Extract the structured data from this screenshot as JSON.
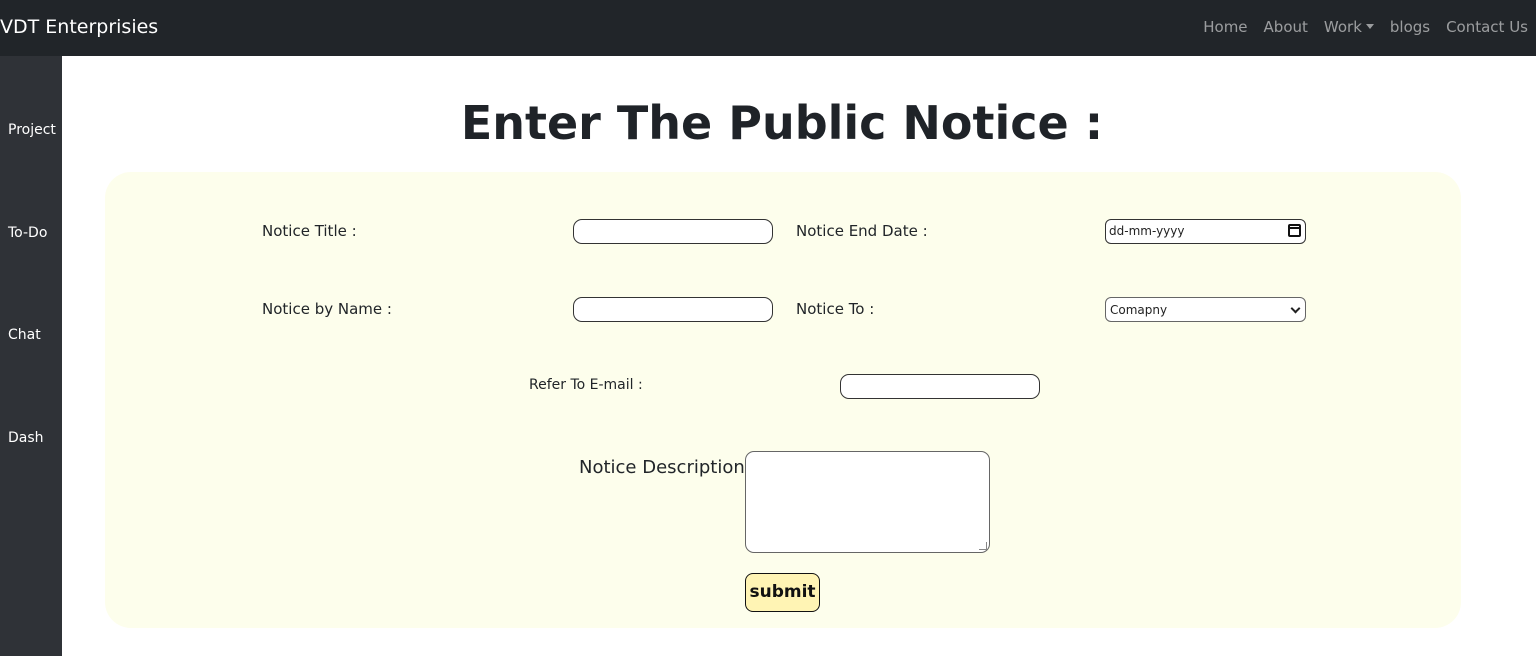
{
  "brand": "VDT Enterprisies",
  "nav": {
    "home": "Home",
    "about": "About",
    "work": "Work",
    "blogs": "blogs",
    "contact": "Contact Us"
  },
  "sidebar": {
    "items": [
      "Project",
      "To-Do",
      "Chat",
      "Dash"
    ]
  },
  "page_title": "Enter The Public Notice :",
  "form": {
    "title_label": "Notice Title :",
    "title_value": "",
    "end_date_label": "Notice End Date :",
    "end_date_placeholder": "dd-mm-yyyy",
    "by_name_label": "Notice by Name :",
    "by_name_value": "",
    "to_label": "Notice To :",
    "to_selected": "Comapny",
    "email_label": "Refer To E-mail :",
    "email_value": "",
    "description_label": "Notice Description :",
    "description_value": "",
    "submit_label": "submit"
  },
  "colors": {
    "navbar_bg": "#212529",
    "sidebar_bg": "#2f3237",
    "card_bg": "#fdfeec",
    "submit_bg": "#fff4b4"
  }
}
